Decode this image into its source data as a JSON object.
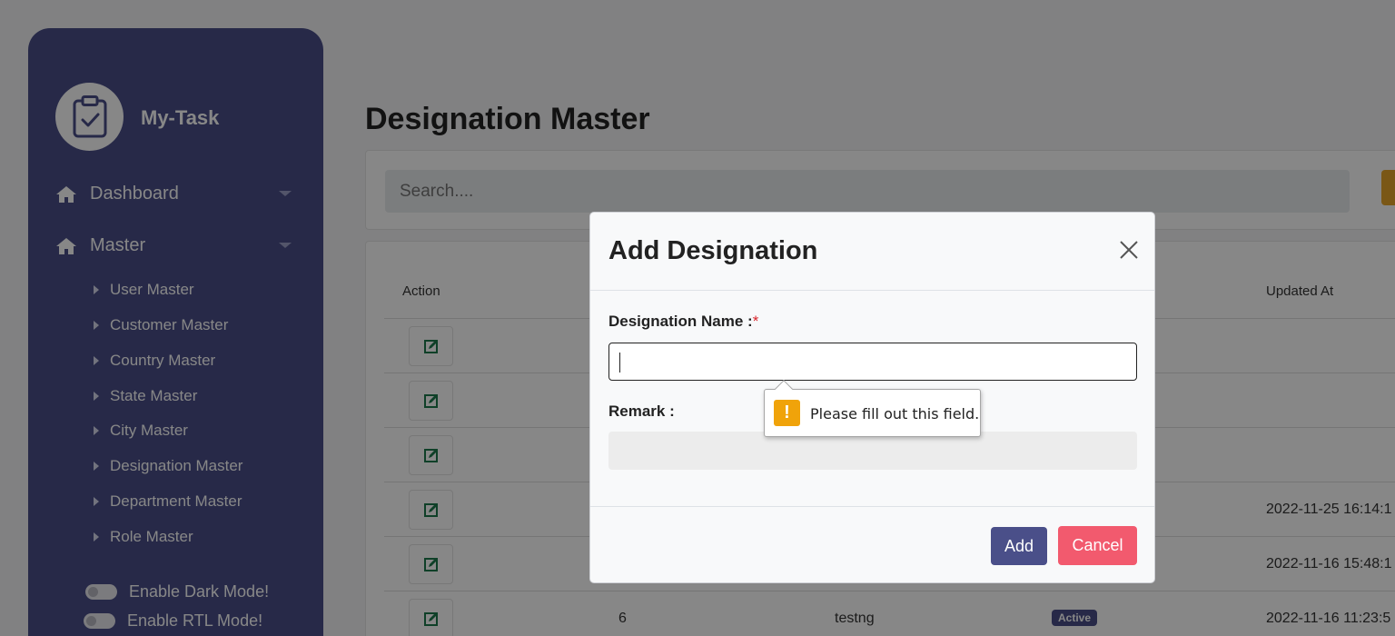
{
  "sidebar": {
    "app_name": "My-Task",
    "nav": [
      {
        "label": "Dashboard"
      },
      {
        "label": "Master"
      }
    ],
    "sub_items": [
      {
        "label": "User Master"
      },
      {
        "label": "Customer Master"
      },
      {
        "label": "Country Master"
      },
      {
        "label": "State Master"
      },
      {
        "label": "City Master"
      },
      {
        "label": "Designation Master"
      },
      {
        "label": "Department Master"
      },
      {
        "label": "Role Master"
      }
    ],
    "toggles": [
      {
        "label": "Enable Dark Mode!"
      },
      {
        "label": "Enable RTL Mode!"
      }
    ]
  },
  "main": {
    "title": "Designation Master",
    "search_placeholder": "Search....",
    "table": {
      "headers": {
        "action": "Action",
        "updated_at": "Updated At"
      },
      "rows": [
        {
          "id": "",
          "name": "",
          "status": "",
          "updated_at": ""
        },
        {
          "id": "",
          "name": "",
          "status": "",
          "updated_at": ""
        },
        {
          "id": "",
          "name": "",
          "status": "",
          "updated_at": ""
        },
        {
          "id": "",
          "name": "",
          "status": "",
          "updated_at": "2022-11-25 16:14:1"
        },
        {
          "id": "",
          "name": "",
          "status": "",
          "updated_at": "2022-11-16 15:48:1"
        },
        {
          "id": "6",
          "name": "testng",
          "status": "Active",
          "updated_at": "2022-11-16 11:23:5"
        }
      ]
    }
  },
  "modal": {
    "title": "Add Designation",
    "name_label": "Designation Name :",
    "required_mark": "*",
    "remark_label": "Remark :",
    "add_label": "Add",
    "cancel_label": "Cancel"
  },
  "tooltip": {
    "icon_text": "!",
    "message": "Please fill out this field."
  },
  "colors": {
    "sidebar": "#4a4f89",
    "primary": "#4a4f89",
    "cancel": "#f25a6e",
    "warning": "#f0a30a"
  }
}
